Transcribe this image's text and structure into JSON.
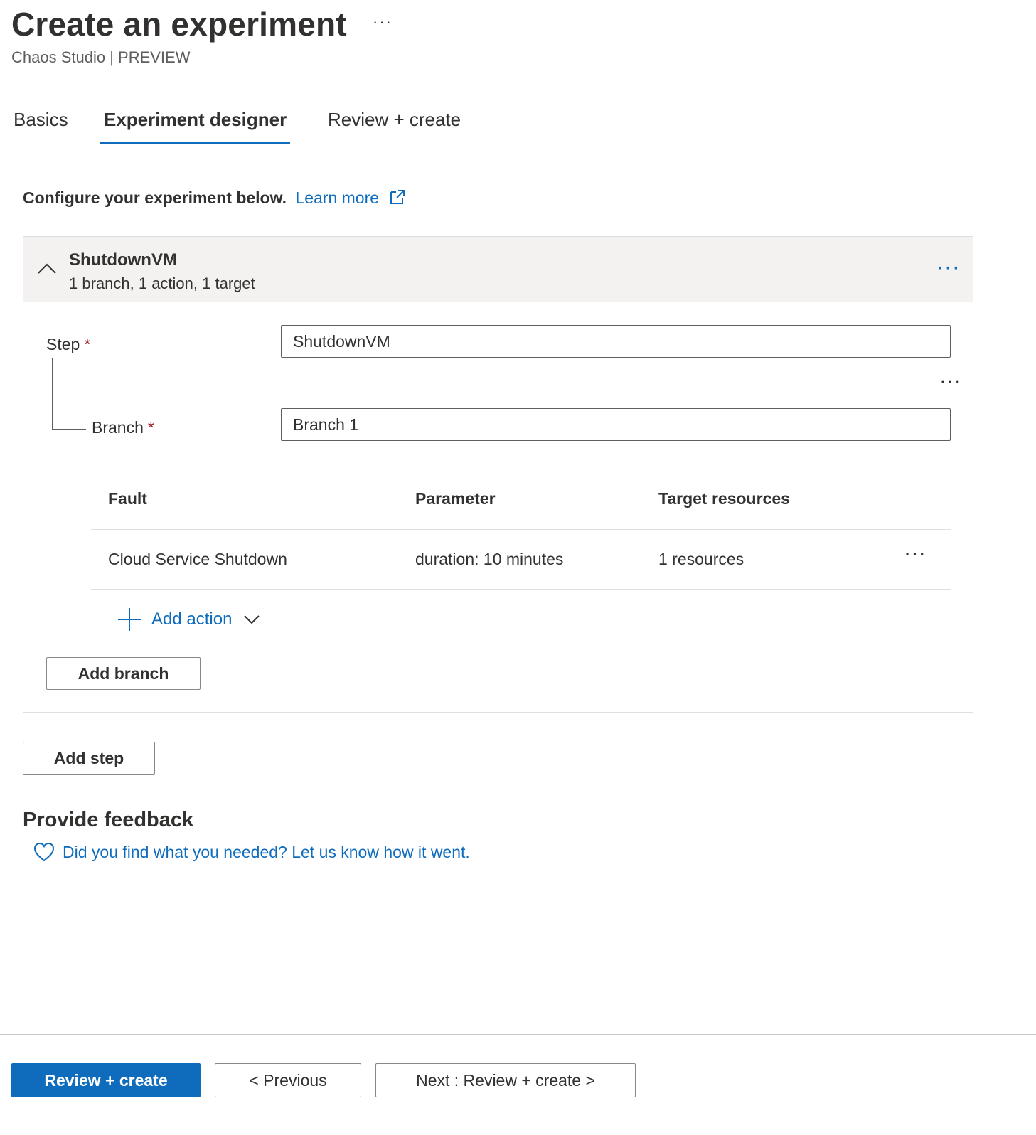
{
  "header": {
    "title": "Create an experiment",
    "more": "···",
    "subtitle": "Chaos Studio | PREVIEW"
  },
  "tabs": [
    {
      "label": "Basics",
      "active": false
    },
    {
      "label": "Experiment designer",
      "active": true
    },
    {
      "label": "Review + create",
      "active": false
    }
  ],
  "intro": {
    "text": "Configure your experiment below.",
    "link": "Learn more",
    "link_icon": "external-link-icon"
  },
  "step": {
    "name": "ShutdownVM",
    "summary": "1 branch, 1 action, 1 target",
    "more": "···",
    "step_label": "Step",
    "required_mark": "*",
    "step_value": "ShutdownVM",
    "branch_label": "Branch",
    "branch_value": "Branch 1",
    "branch_more": "···",
    "table": {
      "headers": [
        "Fault",
        "Parameter",
        "Target resources"
      ],
      "rows": [
        {
          "fault": "Cloud Service Shutdown",
          "parameter": "duration: 10 minutes",
          "targets": "1 resources",
          "more": "···"
        }
      ]
    },
    "add_action": "Add action",
    "add_branch": "Add branch"
  },
  "add_step": "Add step",
  "feedback": {
    "title": "Provide feedback",
    "link": "Did you find what you needed? Let us know how it went.",
    "icon": "heart-icon"
  },
  "footer": {
    "review_create": "Review + create",
    "previous": "< Previous",
    "next": "Next : Review + create >"
  },
  "colors": {
    "accent": "#0f6cbd",
    "required": "#a4262c",
    "header_bg": "#f3f2f1"
  }
}
